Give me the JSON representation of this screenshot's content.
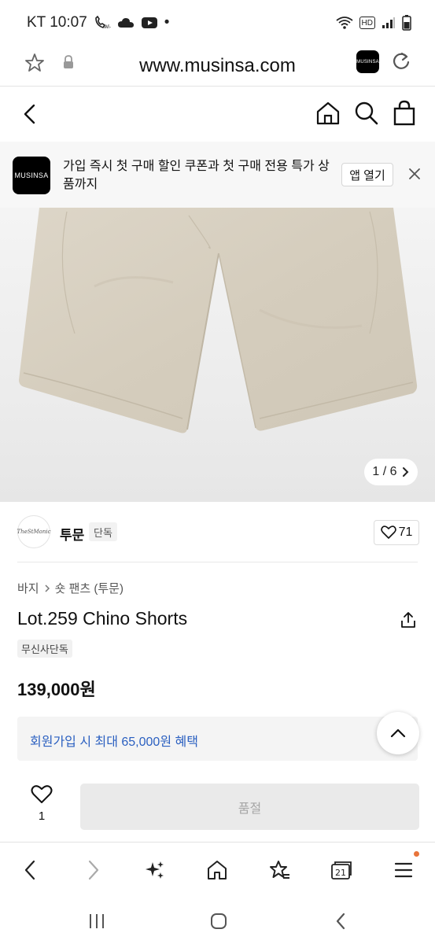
{
  "status_bar": {
    "carrier_time": "KT 10:07",
    "dot": "•",
    "hd_label": "HD"
  },
  "url_bar": {
    "url": "www.musinsa.com",
    "tab_badge": "MUSINSA"
  },
  "promo": {
    "logo": "MUSINSA",
    "text": "가입 즉시 첫 구매 할인 쿠폰과 첫 구매 전용 특가 상품까지",
    "open_button": "앱 열기"
  },
  "image": {
    "counter": "1 / 6"
  },
  "brand": {
    "logo_text": "TheStMonic",
    "name": "투문",
    "badge": "단독",
    "likes": "71"
  },
  "product": {
    "breadcrumb": [
      "바지",
      "숏 팬츠 (투문)"
    ],
    "title": "Lot.259 Chino Shorts",
    "exclusive_tag": "무신사단독",
    "price": "139,000원",
    "benefit": "회원가입 시 최대 65,000원 혜택"
  },
  "buy_bar": {
    "wish_count": "1",
    "button": "품절"
  },
  "browser_nav": {
    "tabs_count": "21"
  },
  "colors": {
    "benefit_text": "#2a5fc0",
    "notification_dot": "#e8743b",
    "shorts": "#d9d2c4"
  }
}
